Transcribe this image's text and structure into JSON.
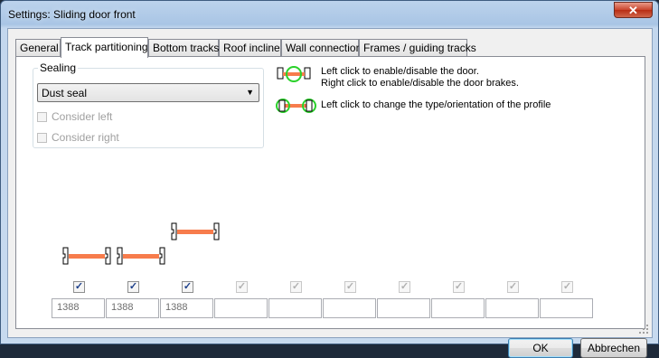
{
  "window": {
    "title": "Settings: Sliding door front",
    "close_glyph": "✕"
  },
  "tabs": [
    {
      "label": "General"
    },
    {
      "label": "Track partitioning"
    },
    {
      "label": "Bottom tracks"
    },
    {
      "label": "Roof incline"
    },
    {
      "label": "Wall connection"
    },
    {
      "label": "Frames / guiding tracks"
    }
  ],
  "sealing": {
    "label": "Sealing",
    "selected": "Dust seal",
    "consider_left": "Consider left",
    "consider_right": "Consider right"
  },
  "hints": {
    "line1": "Left click to enable/disable the door.",
    "line2": "Right click to enable/disable the door brakes.",
    "line3": "Left click to change the type/orientation of the profile"
  },
  "colors": {
    "door_bar": "#f77c4c",
    "hint_circle": "#2bd12b",
    "accent": "#1d3f8a"
  },
  "tracks": {
    "checked": [
      true,
      true,
      true,
      false,
      false,
      false,
      false,
      false,
      false,
      false
    ],
    "values": [
      "1388",
      "1388",
      "1388",
      "",
      "",
      "",
      "",
      "",
      "",
      ""
    ]
  },
  "buttons": {
    "ok": "OK",
    "cancel": "Abbrechen"
  }
}
